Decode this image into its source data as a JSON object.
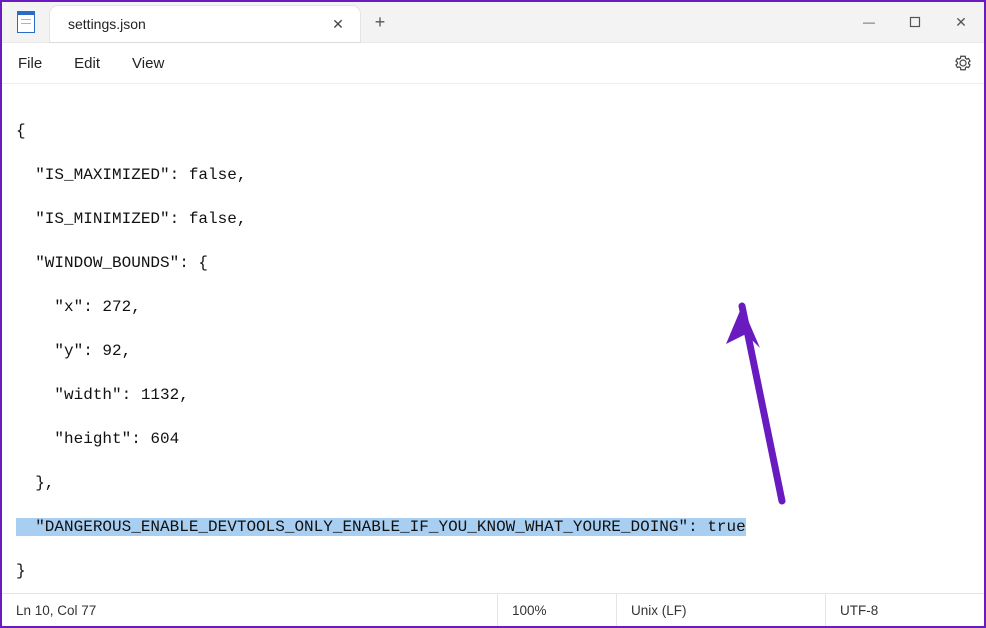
{
  "tab": {
    "title": "settings.json",
    "close_glyph": "✕"
  },
  "titlebar": {
    "new_tab_glyph": "+",
    "minimize_glyph": "—",
    "maximize_glyph": "▢",
    "close_glyph": "✕"
  },
  "menu": {
    "file": "File",
    "edit": "Edit",
    "view": "View"
  },
  "code": {
    "l0": "{",
    "l1": "  \"IS_MAXIMIZED\": false,",
    "l2": "  \"IS_MINIMIZED\": false,",
    "l3": "  \"WINDOW_BOUNDS\": {",
    "l4": "    \"x\": 272,",
    "l5": "    \"y\": 92,",
    "l6": "    \"width\": 1132,",
    "l7": "    \"height\": 604",
    "l8": "  },",
    "l9_hl": "  \"DANGEROUS_ENABLE_DEVTOOLS_ONLY_ENABLE_IF_YOU_KNOW_WHAT_YOURE_DOING\": true",
    "l10": "}"
  },
  "status": {
    "position": "Ln 10, Col 77",
    "zoom": "100%",
    "eol": "Unix (LF)",
    "encoding": "UTF-8"
  }
}
